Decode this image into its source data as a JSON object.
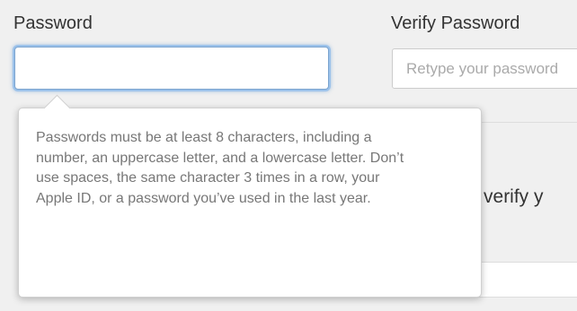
{
  "password": {
    "label": "Password",
    "value": ""
  },
  "verify_password": {
    "label": "Verify Password",
    "placeholder": "Retype your password"
  },
  "tooltip": {
    "text": "Passwords must be at least 8 characters, including a number, an uppercase letter, and a lowercase letter. Don’t use spaces, the same character 3 times in a row, your Apple ID, or a password you’ve used in the last year."
  },
  "background": {
    "heading_partial": "us verify y"
  },
  "colors": {
    "focus_ring": "#9cc2ea",
    "label_text": "#333333",
    "tooltip_text": "#777777",
    "page_background": "#f0f0f0"
  }
}
